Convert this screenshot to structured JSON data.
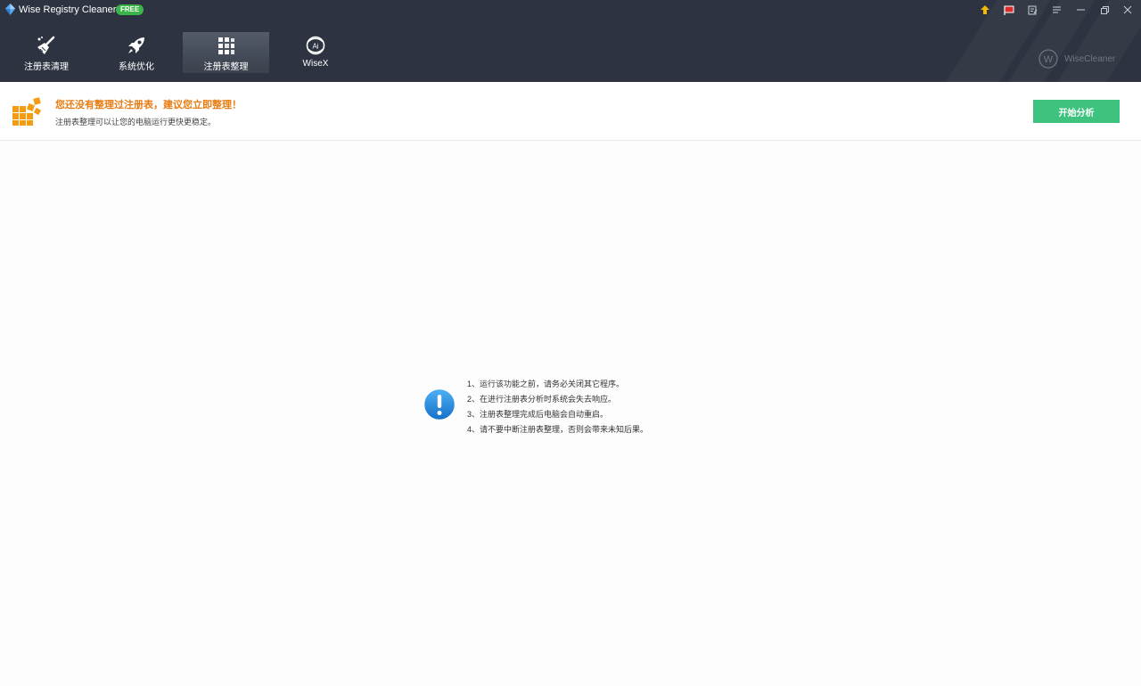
{
  "app": {
    "title": "Wise Registry Cleaner 11",
    "badge": "FREE",
    "logo_icon": "wise-registry-cleaner-logo-icon"
  },
  "window_controls": [
    {
      "name": "upgrade-icon",
      "color": "#f5b800"
    },
    {
      "name": "language-flag-icon"
    },
    {
      "name": "feedback-icon"
    },
    {
      "name": "menu-icon"
    },
    {
      "name": "minimize-icon"
    },
    {
      "name": "restore-icon"
    },
    {
      "name": "close-icon"
    }
  ],
  "nav": {
    "tabs": [
      {
        "label": "注册表清理",
        "icon": "broom-icon",
        "active": false
      },
      {
        "label": "系统优化",
        "icon": "rocket-icon",
        "active": false
      },
      {
        "label": "注册表整理",
        "icon": "grid-blocks-icon",
        "active": true
      },
      {
        "label": "WiseX",
        "icon": "ai-logo-icon",
        "active": false
      }
    ]
  },
  "brand": {
    "text": "WiseCleaner",
    "icon": "wisecleaner-logo-icon"
  },
  "banner": {
    "title": "您还没有整理过注册表，建议您立即整理！",
    "subtitle": "注册表整理可以让您的电脑运行更快更稳定。",
    "button": "开始分析",
    "icon": "registry-defrag-blocks-icon",
    "colors": {
      "title": "#e87c12",
      "button": "#3ec37f",
      "icon": "#f39c12"
    }
  },
  "notes": {
    "icon": "exclamation-info-icon",
    "items": [
      "1、运行该功能之前，请务必关闭其它程序。",
      "2、在进行注册表分析时系统会失去响应。",
      "3、注册表整理完成后电脑会自动重启。",
      "4、请不要中断注册表整理，否则会带来未知后果。"
    ]
  },
  "colors": {
    "header": "#2d3340",
    "background": "#fdfdfd",
    "info_blue": "#1e88e5"
  }
}
